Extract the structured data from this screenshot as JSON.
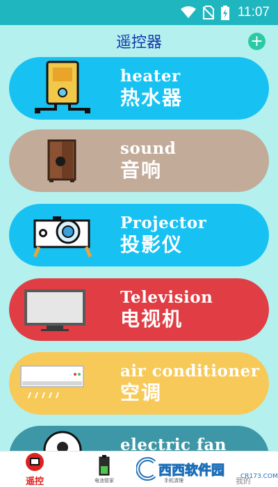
{
  "status_bar": {
    "time": "11:07",
    "icons": [
      "wifi-icon",
      "no-sim-icon",
      "battery-charging-icon"
    ]
  },
  "header": {
    "title": "遥控器",
    "add_icon": "plus-circle-icon",
    "add_symbol": "+",
    "accent_color": "#2cc9a4",
    "title_color": "#1637a8"
  },
  "devices": [
    {
      "name_en": "heater",
      "name_zh": "热水器",
      "color": "#17c2f2",
      "icon": "water-heater-icon"
    },
    {
      "name_en": "sound",
      "name_zh": "音响",
      "color": "#c3ab9a",
      "icon": "speaker-icon"
    },
    {
      "name_en": "Projector",
      "name_zh": "投影仪",
      "color": "#17c2f2",
      "icon": "projector-icon"
    },
    {
      "name_en": "Television",
      "name_zh": "电视机",
      "color": "#e03e44",
      "icon": "television-icon"
    },
    {
      "name_en": "air conditioner",
      "name_zh": "空调",
      "color": "#f7c958",
      "icon": "air-conditioner-icon"
    },
    {
      "name_en": "electric fan",
      "name_zh": "",
      "color": "#3d97a6",
      "icon": "electric-fan-icon"
    }
  ],
  "bottom_nav": {
    "items": [
      {
        "label": "遥控",
        "icon": "tv-remote-icon",
        "active": true
      },
      {
        "label": "电池管家",
        "icon": "battery-icon",
        "active": false
      },
      {
        "label": "手机清理",
        "icon": "phone-clean-icon",
        "active": false
      },
      {
        "label": "我的",
        "icon": "profile-icon",
        "active": false
      }
    ]
  },
  "watermark": {
    "text": "西西软件园",
    "url": "CR173.COM"
  }
}
